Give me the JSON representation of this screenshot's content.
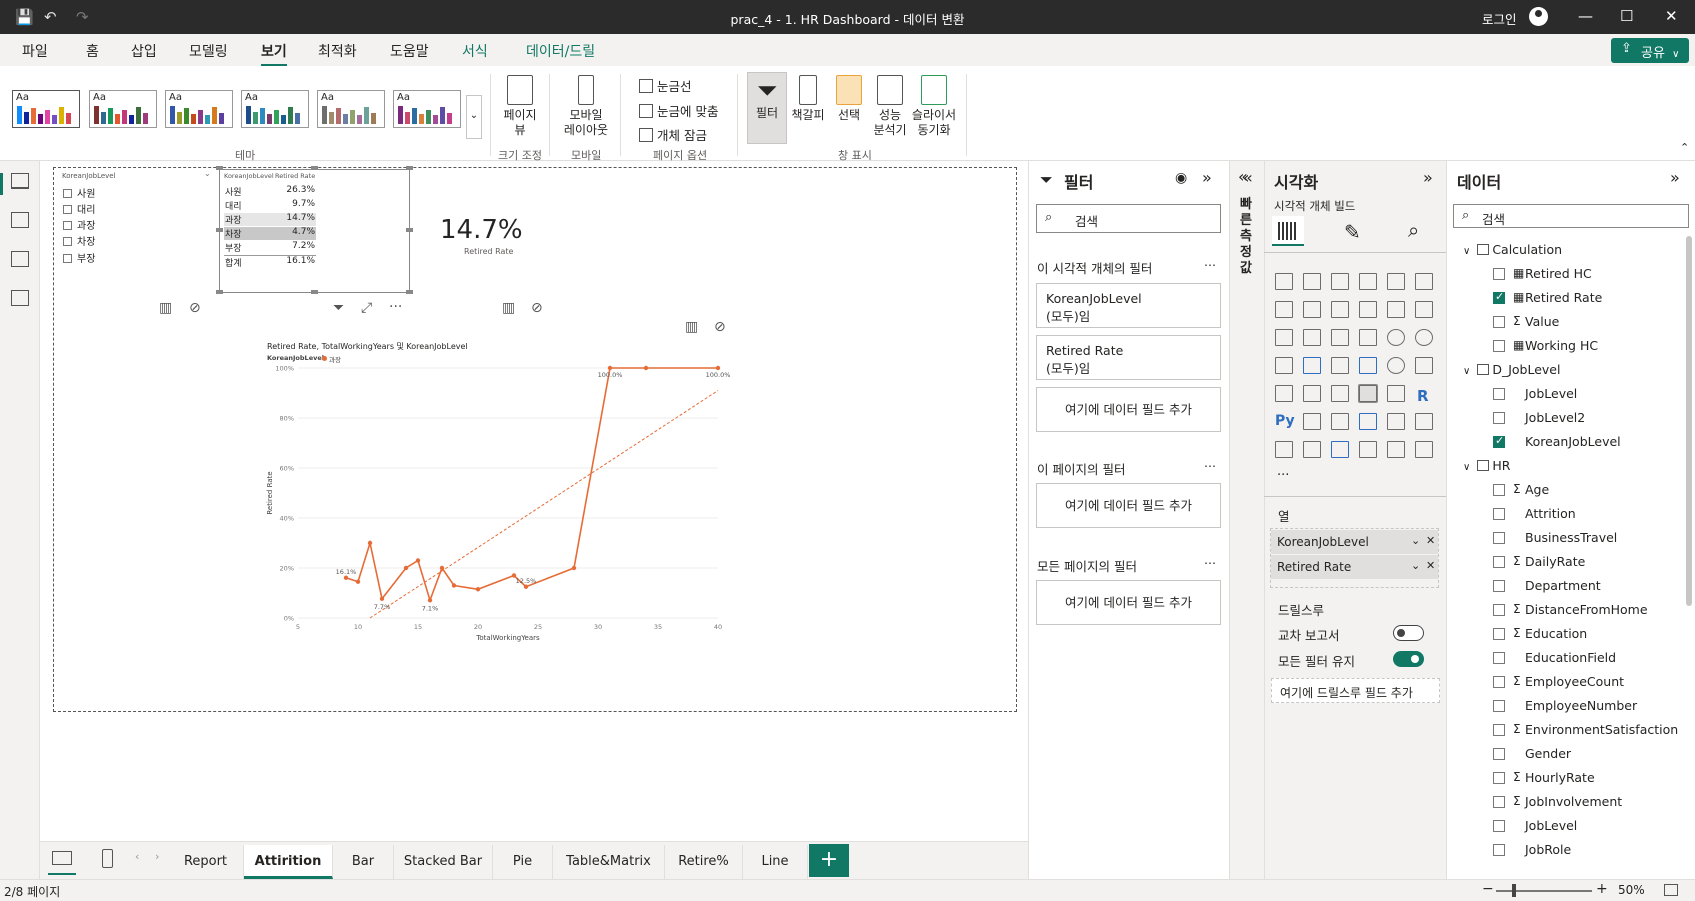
{
  "titlebar": {
    "title": "prac_4 - 1. HR Dashboard - 데이터 변환",
    "login": "로그인",
    "save_icon": "💾",
    "undo_icon": "↶",
    "redo_icon": "↷",
    "minimize": "—",
    "maximize": "☐",
    "close": "✕"
  },
  "menu": {
    "tabs": [
      "파일",
      "홈",
      "삽입",
      "모델링",
      "보기",
      "최적화",
      "도움말",
      "서식",
      "데이터/드릴"
    ],
    "share": "공유"
  },
  "ribbon": {
    "theme_label": "테마",
    "size_label": "크기 조정",
    "mobile_label": "모바일",
    "page_options_label": "페이지 옵션",
    "show_panes_label": "창 표시",
    "page_view": "페이지 뷰",
    "mobile_layout_1": "모바일",
    "mobile_layout_2": "레이아웃",
    "gridlines": "눈금선",
    "snap_to_grid": "눈금에 맞춤",
    "lock_objects": "개체 잠금",
    "filters": "필터",
    "bookmarks": "책갈피",
    "selection": "선택",
    "perf_1": "성능",
    "perf_2": "분석기",
    "sync_1": "슬라이서",
    "sync_2": "동기화",
    "theme_aa": "Aa",
    "theme_colors": [
      [
        "#118dff",
        "#12239e",
        "#e66c37",
        "#6b007b",
        "#e044a7",
        "#744ec2",
        "#d9b300",
        "#d64550"
      ],
      [
        "#7f312f",
        "#2f6b8f",
        "#1a9a5a",
        "#e4562b",
        "#c4377a",
        "#12239e",
        "#3b6f3b",
        "#9e3b7a"
      ],
      [
        "#3257a8",
        "#9b9b25",
        "#3b8a2e",
        "#c24d1b",
        "#8c3a87",
        "#2d9cb3",
        "#d47c1d",
        "#5b3f9e"
      ],
      [
        "#1d4e89",
        "#3d9970",
        "#2e8bc0",
        "#7a3a6b",
        "#33a35b",
        "#1a5d8f",
        "#2f7d4f",
        "#4a6fa5"
      ],
      [
        "#6e6e6e",
        "#a08c6b",
        "#b36b6b",
        "#6b7fa3",
        "#8fa36b",
        "#a36b9e",
        "#6ba39b",
        "#9e7a55"
      ],
      [
        "#7a2a7d",
        "#c94b6e",
        "#2b6ca3",
        "#d9803a",
        "#3e8e5e",
        "#a34b93",
        "#5f4ca3",
        "#c23d8a"
      ]
    ]
  },
  "canvas": {
    "slicer_title": "KoreanJobLevel",
    "slicer_items": [
      "사원",
      "대리",
      "과장",
      "차장",
      "부장"
    ],
    "table_headers": [
      "KoreanJobLevel",
      "Retired Rate"
    ],
    "table_rows": [
      {
        "k": "사원",
        "v": "26.3%"
      },
      {
        "k": "대리",
        "v": "9.7%"
      },
      {
        "k": "과장",
        "v": "14.7%"
      },
      {
        "k": "차장",
        "v": "4.7%"
      },
      {
        "k": "부장",
        "v": "7.2%"
      },
      {
        "k": "합계",
        "v": "16.1%"
      }
    ],
    "kpi_value": "14.7%",
    "kpi_label": "Retired Rate",
    "chart_title": "Retired Rate, TotalWorkingYears 및 KoreanJobLevel",
    "legend_title": "KoreanJobLevel",
    "legend_item": "과장",
    "series_color": "#e66c37"
  },
  "chart_data": {
    "type": "line",
    "title": "Retired Rate, TotalWorkingYears 및 KoreanJobLevel",
    "xlabel": "TotalWorkingYears",
    "ylabel": "Retired Rate",
    "xlim": [
      5,
      40
    ],
    "ylim": [
      0,
      100
    ],
    "x_ticks": [
      "5",
      "10",
      "15",
      "20",
      "25",
      "30",
      "35",
      "40"
    ],
    "y_ticks": [
      "0%",
      "20%",
      "40%",
      "60%",
      "80%",
      "100%"
    ],
    "legend": "top-left",
    "series": [
      {
        "name": "과장",
        "x": [
          9,
          10,
          11,
          12,
          14,
          15,
          16,
          17,
          18,
          20,
          23,
          24,
          28,
          31,
          34,
          40
        ],
        "values": [
          16.1,
          14.5,
          30,
          7.7,
          20,
          23,
          7.1,
          20,
          13,
          11.5,
          17,
          12.5,
          20,
          100,
          100,
          100
        ]
      }
    ],
    "data_labels": [
      {
        "x": 9,
        "y": 16.1,
        "text": "16.1%"
      },
      {
        "x": 12,
        "y": 7.7,
        "text": "7.7%"
      },
      {
        "x": 16,
        "y": 7.1,
        "text": "7.1%"
      },
      {
        "x": 24,
        "y": 12.5,
        "text": "12.5%"
      },
      {
        "x": 31,
        "y": 100,
        "text": "100.0%"
      },
      {
        "x": 40,
        "y": 100,
        "text": "100.0%"
      }
    ],
    "trendline": {
      "x": [
        11,
        40
      ],
      "y": [
        0,
        91
      ]
    }
  },
  "page_tabs": [
    "Report",
    "Attirition",
    "Bar",
    "Stacked Bar",
    "Pie",
    "Table&Matrix",
    "Retire%",
    "Line"
  ],
  "status": {
    "page": "2/8 페이지",
    "zoom": "50%"
  },
  "filters": {
    "title": "필터",
    "search": "검색",
    "visual_section": "이 시각적 개체의 필터",
    "page_section": "이 페이지의 필터",
    "all_section": "모든 페이지의 필터",
    "card1_field": "KoreanJobLevel",
    "card1_state": "(모두)임",
    "card2_field": "Retired Rate",
    "card2_state": "(모두)임",
    "add_field": "여기에 데이터 필드 추가",
    "more": "…"
  },
  "quick": {
    "label": "빠른 측정값"
  },
  "viz": {
    "title": "시각화",
    "build_label": "시각적 개체 빌드",
    "columns_label": "열",
    "well_fields": [
      "KoreanJobLevel",
      "Retired Rate"
    ],
    "drillthrough": "드릴스루",
    "cross_report": "교차 보고서",
    "keep_filters": "모든 필터 유지",
    "add_drill": "여기에 드릴스루 필드 추가",
    "r_visual": "R",
    "py_visual": "Py",
    "more": "···"
  },
  "data": {
    "title": "데이터",
    "search": "검색",
    "tables": [
      {
        "name": "Calculation",
        "fields": [
          {
            "name": "Retired HC",
            "sig": "▦",
            "checked": false
          },
          {
            "name": "Retired Rate",
            "sig": "▦",
            "checked": true
          },
          {
            "name": "Value",
            "sig": "Σ",
            "checked": false
          },
          {
            "name": "Working HC",
            "sig": "▦",
            "checked": false
          }
        ]
      },
      {
        "name": "D_JobLevel",
        "fields": [
          {
            "name": "JobLevel",
            "sig": "",
            "checked": false
          },
          {
            "name": "JobLevel2",
            "sig": "",
            "checked": false
          },
          {
            "name": "KoreanJobLevel",
            "sig": "",
            "checked": true
          }
        ]
      },
      {
        "name": "HR",
        "fields": [
          {
            "name": "Age",
            "sig": "Σ",
            "checked": false
          },
          {
            "name": "Attrition",
            "sig": "",
            "checked": false
          },
          {
            "name": "BusinessTravel",
            "sig": "",
            "checked": false
          },
          {
            "name": "DailyRate",
            "sig": "Σ",
            "checked": false
          },
          {
            "name": "Department",
            "sig": "",
            "checked": false
          },
          {
            "name": "DistanceFromHome",
            "sig": "Σ",
            "checked": false
          },
          {
            "name": "Education",
            "sig": "Σ",
            "checked": false
          },
          {
            "name": "EducationField",
            "sig": "",
            "checked": false
          },
          {
            "name": "EmployeeCount",
            "sig": "Σ",
            "checked": false
          },
          {
            "name": "EmployeeNumber",
            "sig": "",
            "checked": false
          },
          {
            "name": "EnvironmentSatisfaction",
            "sig": "Σ",
            "checked": false
          },
          {
            "name": "Gender",
            "sig": "",
            "checked": false
          },
          {
            "name": "HourlyRate",
            "sig": "Σ",
            "checked": false
          },
          {
            "name": "JobInvolvement",
            "sig": "Σ",
            "checked": false
          },
          {
            "name": "JobLevel",
            "sig": "",
            "checked": false
          },
          {
            "name": "JobRole",
            "sig": "",
            "checked": false
          }
        ]
      }
    ]
  }
}
